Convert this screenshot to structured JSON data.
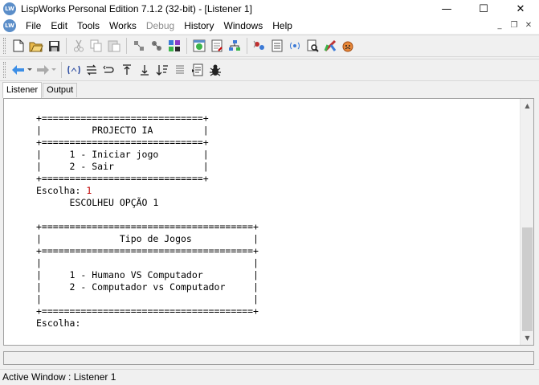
{
  "window": {
    "title": "LispWorks Personal Edition 7.1.2 (32-bit) - [Listener 1]",
    "app_icon_text": "LW",
    "controls": {
      "minimize": "—",
      "maximize": "☐",
      "close": "✕"
    }
  },
  "menubar": {
    "items": [
      {
        "label": "File",
        "enabled": true
      },
      {
        "label": "Edit",
        "enabled": true
      },
      {
        "label": "Tools",
        "enabled": true
      },
      {
        "label": "Works",
        "enabled": true
      },
      {
        "label": "Debug",
        "enabled": false
      },
      {
        "label": "History",
        "enabled": true
      },
      {
        "label": "Windows",
        "enabled": true
      },
      {
        "label": "Help",
        "enabled": true
      }
    ],
    "mdi_controls": {
      "minimize": "_",
      "restore": "❐",
      "close": "✕"
    }
  },
  "tabs": [
    {
      "label": "Listener",
      "active": true
    },
    {
      "label": "Output",
      "active": false
    }
  ],
  "listener": {
    "menu1_border": "+=============================+",
    "menu1_title": "|         PROJECTO IA         |",
    "menu1_option1": "|     1 - Iniciar jogo        |",
    "menu1_option2": "|     2 - Sair                |",
    "prompt1_label": "Escolha: ",
    "prompt1_input": "1",
    "response1": "      ESCOLHEU OPÇÃO 1",
    "menu2_border": "+======================================+",
    "menu2_title": "|              Tipo de Jogos           |",
    "menu2_blank": "|                                      |",
    "menu2_option1": "|     1 - Humano VS Computador         |",
    "menu2_option2": "|     2 - Computador vs Computador     |",
    "prompt2_label": "Escolha:",
    "input_color": "#c00000"
  },
  "scrollbar": {
    "up": "▲",
    "down": "▼",
    "thumb_fraction": 0.42
  },
  "status": {
    "text": "Active Window : Listener 1"
  },
  "colors": {
    "accent": "#5b8ec9",
    "background": "#f0f0f0",
    "content": "#ffffff"
  }
}
